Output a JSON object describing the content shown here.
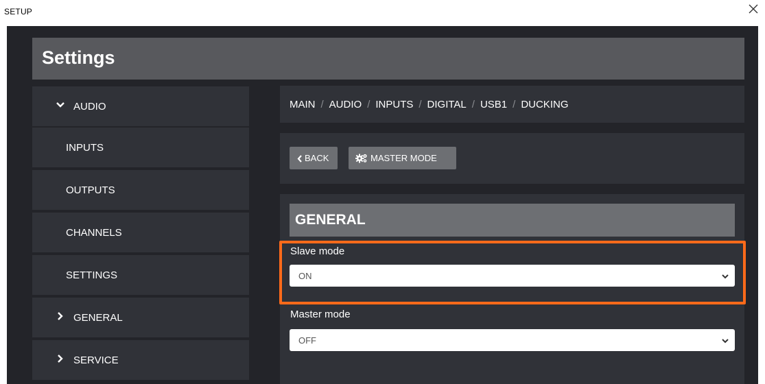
{
  "window": {
    "title": "SETUP",
    "close_icon": "close-icon"
  },
  "header": {
    "title": "Settings"
  },
  "sidebar": {
    "items": [
      {
        "label": "AUDIO",
        "type": "group",
        "expanded": true,
        "icon": "chevron-down-icon"
      },
      {
        "label": "INPUTS",
        "type": "sub"
      },
      {
        "label": "OUTPUTS",
        "type": "sub"
      },
      {
        "label": "CHANNELS",
        "type": "sub"
      },
      {
        "label": "SETTINGS",
        "type": "sub"
      },
      {
        "label": "GENERAL",
        "type": "group",
        "expanded": false,
        "icon": "chevron-right-icon"
      },
      {
        "label": "SERVICE",
        "type": "group",
        "expanded": false,
        "icon": "chevron-right-icon"
      }
    ]
  },
  "breadcrumb": [
    "MAIN",
    "AUDIO",
    "INPUTS",
    "DIGITAL",
    "USB1",
    "DUCKING"
  ],
  "toolbar": {
    "back_label": "BACK",
    "back_icon": "chevron-left-icon",
    "master_mode_label": "MASTER MODE",
    "master_mode_icon": "gears-icon"
  },
  "section": {
    "title": "GENERAL"
  },
  "fields": {
    "slave_mode": {
      "label": "Slave mode",
      "value": "ON"
    },
    "master_mode": {
      "label": "Master mode",
      "value": "OFF"
    }
  },
  "colors": {
    "background": "#232429",
    "panel": "#303238",
    "header": "#58595d",
    "button": "#6d6f73",
    "highlight": "#ff6a1a"
  }
}
